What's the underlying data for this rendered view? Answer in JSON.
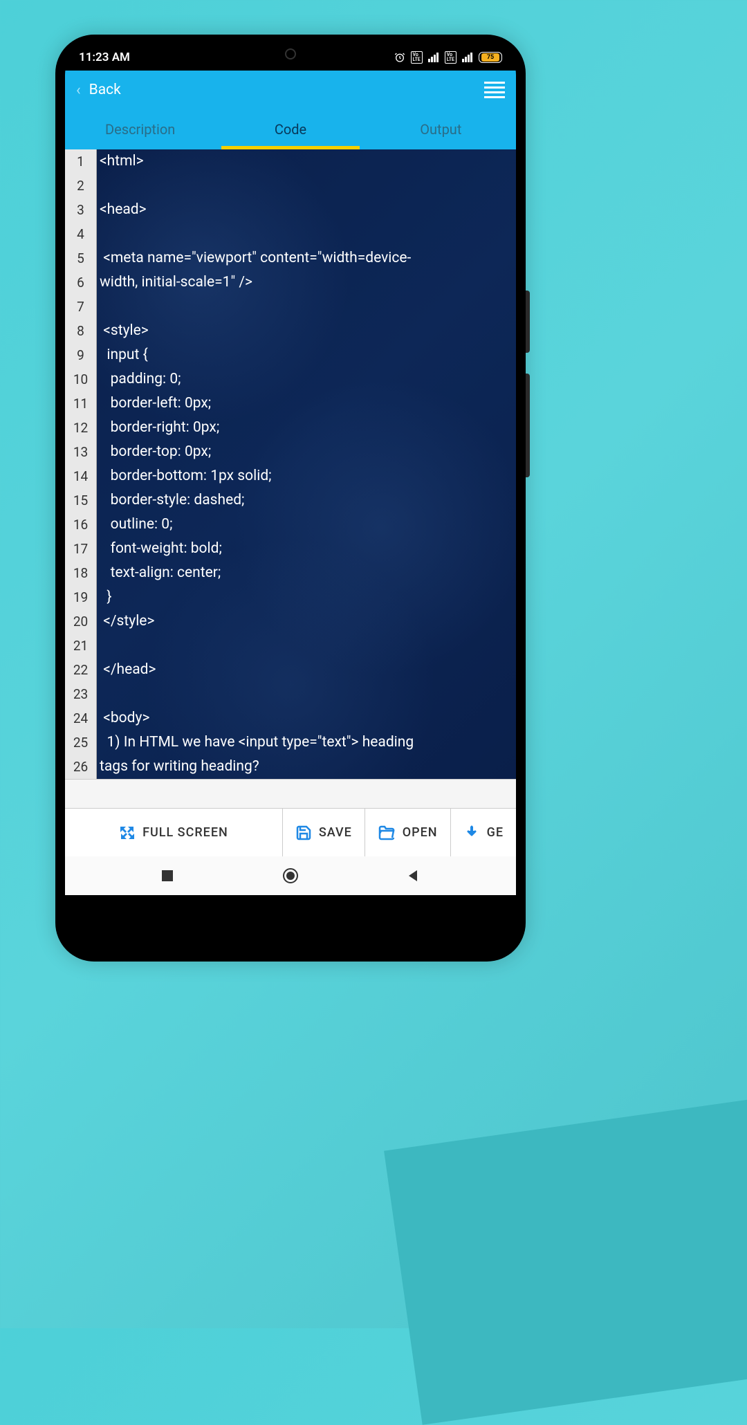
{
  "status_bar": {
    "time": "11:23 AM",
    "battery": "75"
  },
  "header": {
    "back_label": "Back"
  },
  "tabs": [
    {
      "label": "Description",
      "active": false
    },
    {
      "label": "Code",
      "active": true
    },
    {
      "label": "Output",
      "active": false
    }
  ],
  "code": {
    "lines": [
      "<html>",
      "",
      "<head>",
      "",
      " <meta name=\"viewport\" content=\"width=device-",
      "width, initial-scale=1\" />",
      "",
      " <style>",
      "  input {",
      "   padding: 0;",
      "   border-left: 0px;",
      "   border-right: 0px;",
      "   border-top: 0px;",
      "   border-bottom: 1px solid;",
      "   border-style: dashed;",
      "   outline: 0;",
      "   font-weight: bold;",
      "   text-align: center;",
      "  }",
      " </style>",
      "",
      " </head>",
      "",
      " <body>",
      "  1) In HTML we have <input type=\"text\"> heading",
      "tags for writing heading?"
    ],
    "line_numbers": [
      "1",
      "2",
      "3",
      "4",
      "5",
      "6",
      "7",
      "8",
      "9",
      "10",
      "11",
      "12",
      "13",
      "14",
      "15",
      "16",
      "17",
      "18",
      "19",
      "20",
      "21",
      "22",
      "23",
      "24",
      "25",
      "26"
    ]
  },
  "toolbar": {
    "fullscreen_label": "FULL SCREEN",
    "save_label": "SAVE",
    "open_label": "OPEN",
    "get_label": "GE"
  }
}
